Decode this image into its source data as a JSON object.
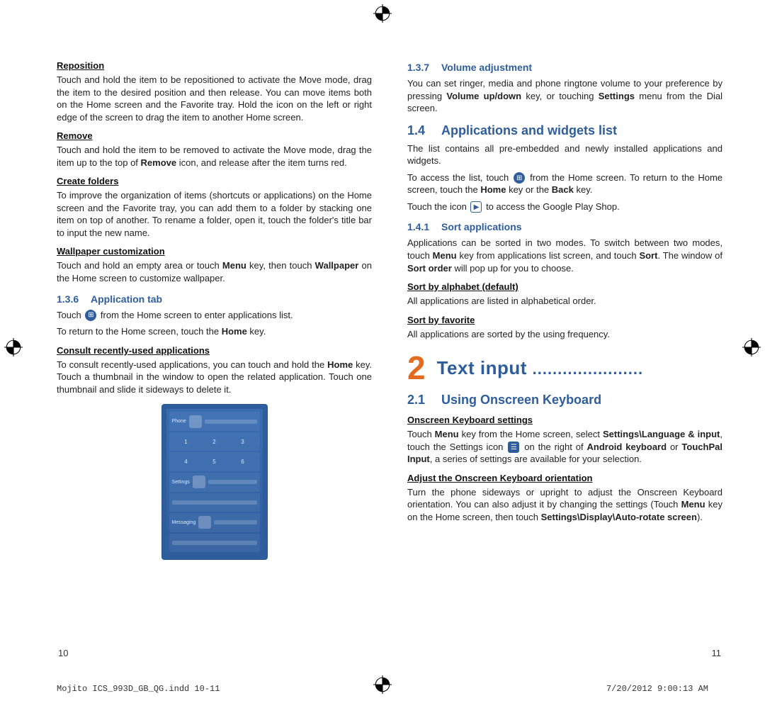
{
  "left": {
    "reposition": {
      "title": "Reposition",
      "body": "Touch and hold the item to be repositioned to activate the Move mode, drag the item to the desired position and then release. You can move items both on the Home screen and the Favorite tray. Hold the icon on the left or right edge of the screen to drag the item to another Home screen."
    },
    "remove": {
      "title": "Remove",
      "body_a": "Touch and hold the item to be removed to activate the Move mode, drag the item up to the top of ",
      "body_b": "Remove",
      "body_c": " icon, and release after the item turns red."
    },
    "folders": {
      "title": "Create folders",
      "body": "To improve the organization of items (shortcuts or applications) on the Home screen and the Favorite tray, you can add them to a folder by stacking one item on top of another. To rename a folder, open it, touch the folder's title bar to input the new name."
    },
    "wallpaper": {
      "title": "Wallpaper customization",
      "body_a": "Touch and hold an empty area or touch ",
      "body_b": "Menu",
      "body_c": " key,  then touch ",
      "body_d": "Wallpaper",
      "body_e": " on the Home screen to customize wallpaper."
    },
    "sec136": {
      "num": "1.3.6",
      "title": "Application tab"
    },
    "apptab": {
      "line1_a": "Touch ",
      "line1_b": " from the Home screen to enter applications list.",
      "line2_a": "To return to the Home screen, touch the ",
      "line2_b": "Home",
      "line2_c": " key."
    },
    "recent": {
      "title": "Consult recently-used applications",
      "body_a": "To consult recently-used applications, you can touch and hold the ",
      "body_b": "Home",
      "body_c": " key. Touch a thumbnail in the window to open the related application. Touch one thumbnail and slide it sideways to delete it."
    },
    "pagenum": "10"
  },
  "right": {
    "sec137": {
      "num": "1.3.7",
      "title": "Volume adjustment"
    },
    "volume_a": "You can set ringer, media and phone ringtone volume to your preference by pressing ",
    "volume_b": "Volume up/down",
    "volume_c": " key, or touching ",
    "volume_d": "Settings",
    "volume_e": " menu from the Dial screen.",
    "sec14": {
      "num": "1.4",
      "title": "Applications and widgets list"
    },
    "apps_intro": "The list contains all pre-embedded and newly installed applications and widgets.",
    "apps_access_a": "To access the list, touch ",
    "apps_access_b": " from the Home screen. To return to the Home screen, touch the ",
    "apps_access_c": "Home",
    "apps_access_d": " key or the ",
    "apps_access_e": "Back",
    "apps_access_f": " key.",
    "play_a": "Touch the icon ",
    "play_b": " to access the Google Play Shop.",
    "sec141": {
      "num": "1.4.1",
      "title": "Sort applications"
    },
    "sort_body_a": "Applications can be sorted in two modes. To switch between two modes, touch ",
    "sort_body_b": "Menu",
    "sort_body_c": " key from applications list screen, and touch ",
    "sort_body_d": "Sort",
    "sort_body_e": ". The window of ",
    "sort_body_f": "Sort order",
    "sort_body_g": " will pop up for you to choose.",
    "sort_alpha_t": "Sort by alphabet  (default)",
    "sort_alpha_b": "All applications are listed in alphabetical order.",
    "sort_fav_t": "Sort by favorite",
    "sort_fav_b": "All applications are sorted by the using frequency.",
    "chapter": {
      "num": "2",
      "title": "Text input",
      "dots": "......................"
    },
    "sec21": {
      "num": "2.1",
      "title": "Using Onscreen Keyboard"
    },
    "kb_settings_t": "Onscreen Keyboard settings",
    "kb_body_a": "Touch ",
    "kb_body_b": "Menu",
    "kb_body_c": " key from the Home screen, select ",
    "kb_body_d": "Settings\\Language & input",
    "kb_body_e": ", touch the Settings icon ",
    "kb_body_f": " on the right of ",
    "kb_body_g": "Android keyboard",
    "kb_body_h": " or ",
    "kb_body_i": "TouchPal Input",
    "kb_body_j": ", a series of settings are available for your selection.",
    "orient_t": "Adjust the Onscreen Keyboard orientation",
    "orient_a": "Turn the phone sideways or upright to adjust the Onscreen Keyboard orientation. You can also adjust it by changing the settings (Touch ",
    "orient_b": "Menu",
    "orient_c": " key on the  Home screen, then touch ",
    "orient_d": "Settings\\Display\\Auto-rotate screen",
    "orient_e": ").",
    "pagenum": "11"
  },
  "footer": {
    "file": "Mojito ICS_993D_GB_QG.indd   10-11",
    "date": "7/20/2012   9:00:13 AM"
  }
}
